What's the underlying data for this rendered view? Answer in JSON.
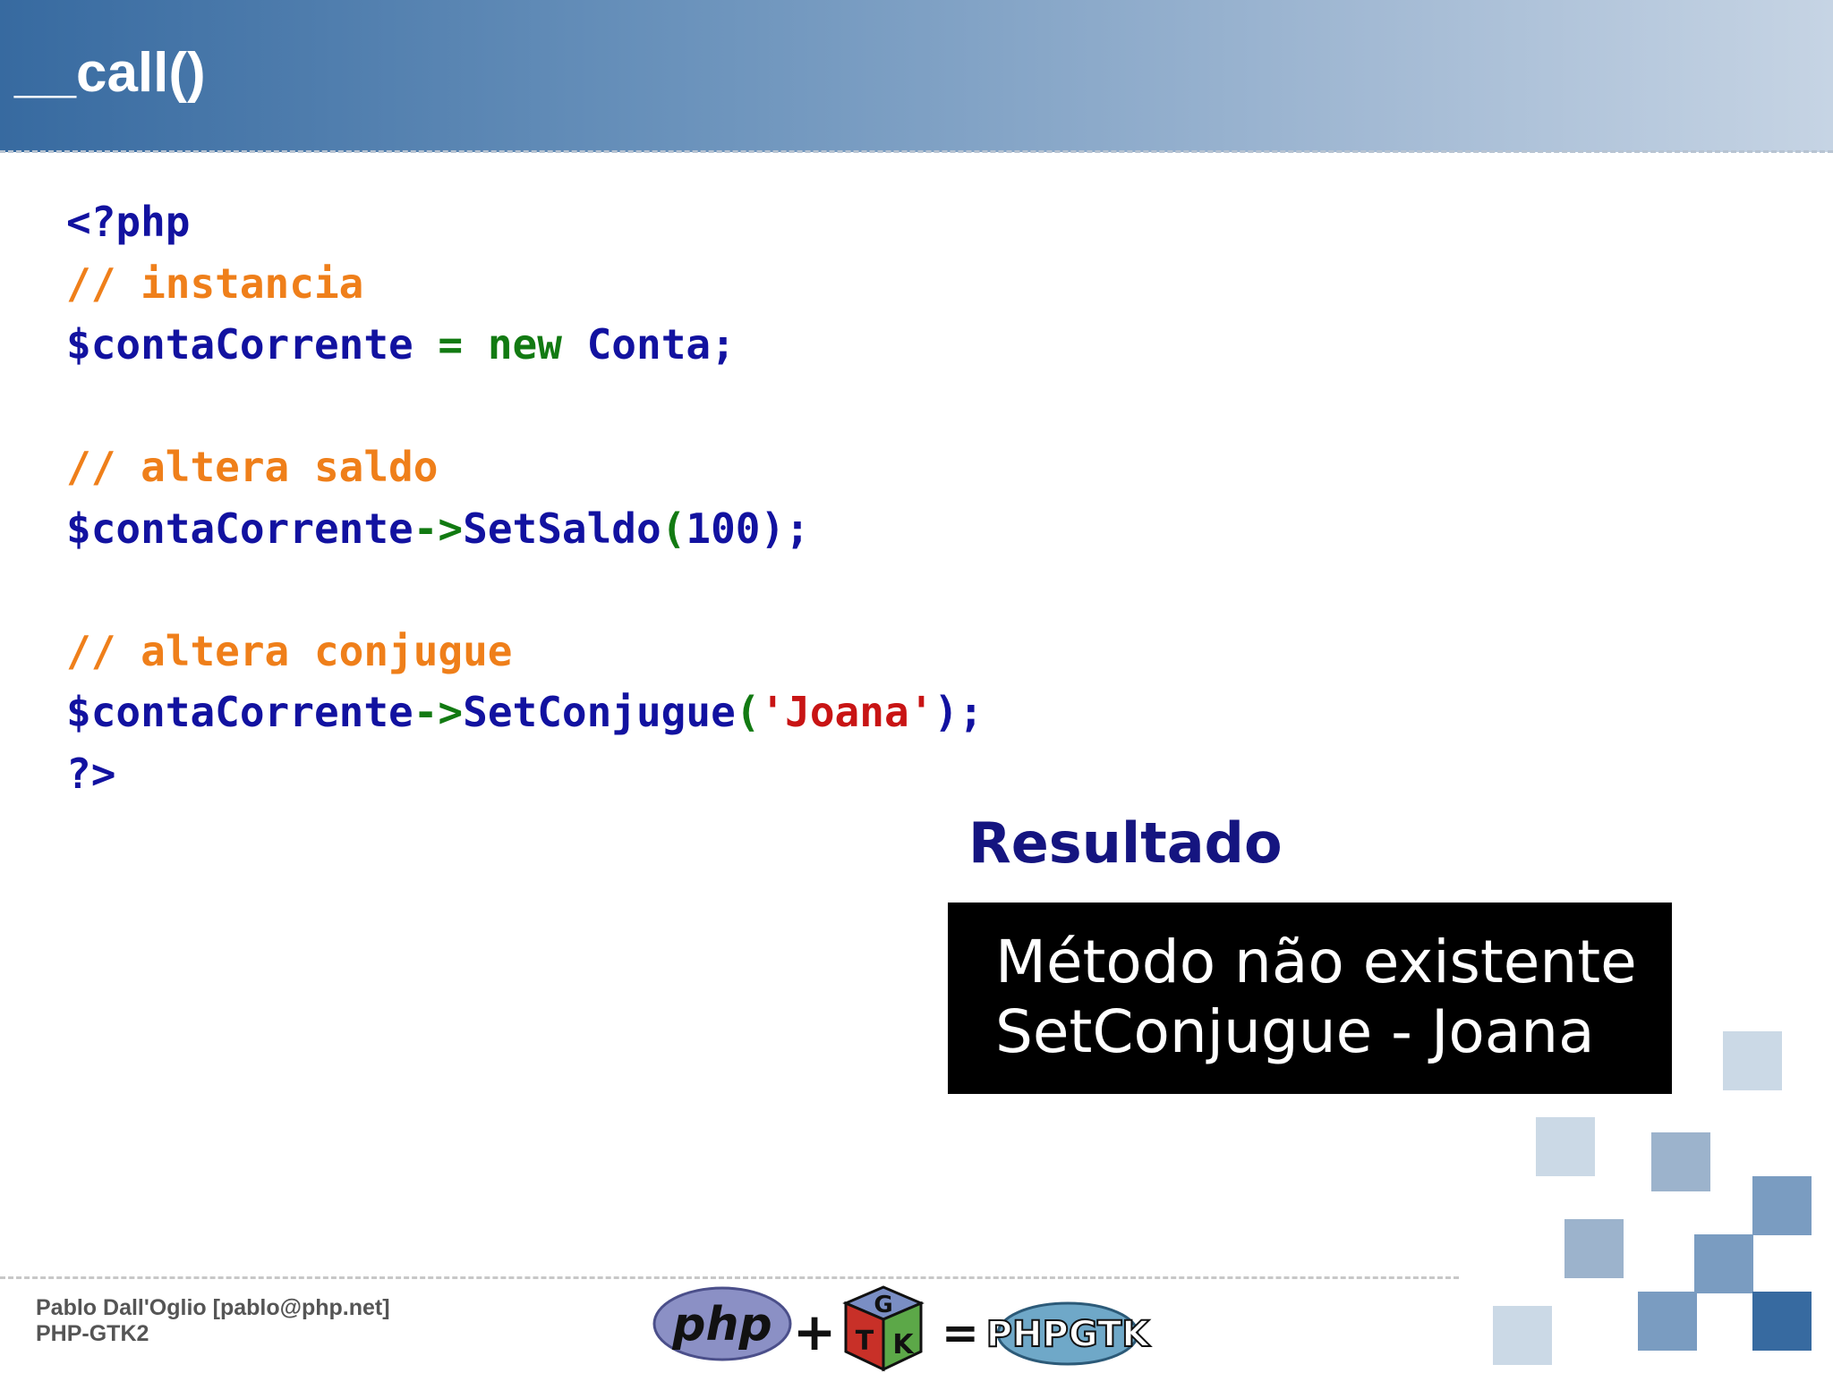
{
  "slide": {
    "title": "__call()"
  },
  "code_lines": [
    [
      {
        "t": "<?php",
        "c": "tag"
      }
    ],
    [
      {
        "t": "// instancia",
        "c": "cmt"
      }
    ],
    [
      {
        "t": "$contaCorrente",
        "c": "var"
      },
      {
        "t": " = ",
        "c": "op"
      },
      {
        "t": "new",
        "c": "kw"
      },
      {
        "t": " Conta",
        "c": "cls"
      },
      {
        "t": ";",
        "c": "var"
      }
    ],
    [],
    [
      {
        "t": "// altera saldo",
        "c": "cmt"
      }
    ],
    [
      {
        "t": "$contaCorrente",
        "c": "var"
      },
      {
        "t": "->",
        "c": "op"
      },
      {
        "t": "SetSaldo",
        "c": "cls"
      },
      {
        "t": "(",
        "c": "punc"
      },
      {
        "t": "100",
        "c": "var"
      },
      {
        "t": ");",
        "c": "var"
      }
    ],
    [],
    [
      {
        "t": "// altera conjugue",
        "c": "cmt"
      }
    ],
    [
      {
        "t": "$contaCorrente",
        "c": "var"
      },
      {
        "t": "->",
        "c": "op"
      },
      {
        "t": "SetConjugue",
        "c": "cls"
      },
      {
        "t": "(",
        "c": "punc"
      },
      {
        "t": "'Joana'",
        "c": "str"
      },
      {
        "t": ");",
        "c": "var"
      }
    ],
    [
      {
        "t": "?>",
        "c": "tag"
      }
    ]
  ],
  "result": {
    "heading": "Resultado",
    "lines": [
      "Método não existente",
      "SetConjugue - Joana"
    ]
  },
  "footer": {
    "author": "Pablo Dall'Oglio [pablo@php.net]",
    "project": "PHP-GTK2",
    "logo_php": "php",
    "logo_plus": "+",
    "logo_gtk_letters": [
      "G",
      "T",
      "K"
    ],
    "logo_equals": "=",
    "logo_phpgtk": "PHPGTK"
  },
  "colors": {
    "header_start": "#376aa0",
    "header_end": "#c6d4e4",
    "code_blue": "#1212a0",
    "code_comment": "#ef7f1a",
    "code_keyword": "#127a12",
    "code_string": "#c81414",
    "result_heading": "#151580",
    "result_box": "#000000"
  }
}
